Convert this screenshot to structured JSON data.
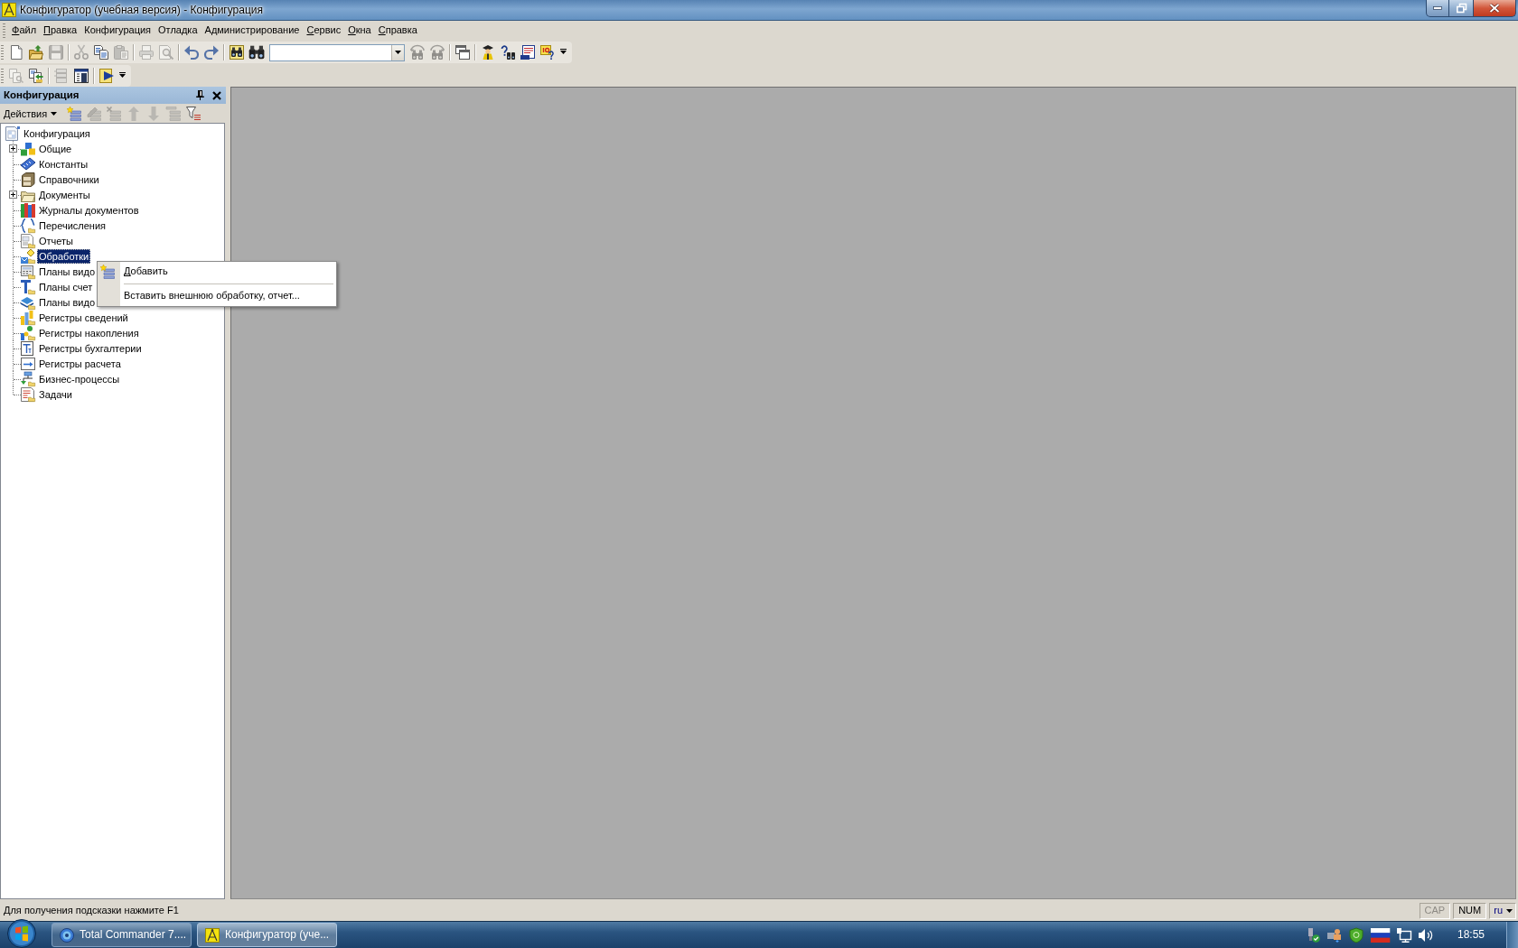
{
  "window": {
    "title": "Конфигуратор (учебная версия) - Конфигурация"
  },
  "menu_bar": [
    {
      "label": "Файл",
      "mnemonic": true
    },
    {
      "label": "Правка",
      "mnemonic": true
    },
    {
      "label": "Конфигурация",
      "mnemonic": false
    },
    {
      "label": "Отладка",
      "mnemonic": false
    },
    {
      "label": "Администрирование",
      "mnemonic": false
    },
    {
      "label": "Сервис",
      "mnemonic": true
    },
    {
      "label": "Окна",
      "mnemonic": true
    },
    {
      "label": "Справка",
      "mnemonic": true
    }
  ],
  "toolbars": [
    {
      "items": [
        {
          "kind": "button",
          "disabled": false
        },
        {
          "kind": "button",
          "disabled": false
        },
        {
          "kind": "button",
          "disabled": true
        },
        {
          "kind": "separator"
        },
        {
          "kind": "button",
          "disabled": true
        },
        {
          "kind": "button",
          "disabled": false
        },
        {
          "kind": "button",
          "disabled": true
        },
        {
          "kind": "separator"
        },
        {
          "kind": "button",
          "disabled": true
        },
        {
          "kind": "button",
          "disabled": true
        },
        {
          "kind": "separator"
        },
        {
          "kind": "button",
          "disabled": false
        },
        {
          "kind": "button",
          "disabled": false
        },
        {
          "kind": "separator"
        },
        {
          "kind": "button",
          "disabled": false
        },
        {
          "kind": "button",
          "disabled": false
        },
        {
          "kind": "combo"
        },
        {
          "kind": "button",
          "disabled": true
        },
        {
          "kind": "button",
          "disabled": true
        },
        {
          "kind": "separator"
        },
        {
          "kind": "button",
          "disabled": false
        },
        {
          "kind": "separator"
        },
        {
          "kind": "button",
          "disabled": false
        },
        {
          "kind": "button",
          "disabled": false
        },
        {
          "kind": "button",
          "disabled": false
        },
        {
          "kind": "button",
          "disabled": false
        },
        {
          "kind": "dropdown"
        }
      ]
    },
    {
      "items": [
        {
          "kind": "button",
          "disabled": true
        },
        {
          "kind": "button",
          "disabled": false
        },
        {
          "kind": "separator"
        },
        {
          "kind": "button",
          "disabled": true
        },
        {
          "kind": "button",
          "disabled": false
        },
        {
          "kind": "separator"
        },
        {
          "kind": "button",
          "disabled": false
        },
        {
          "kind": "dropdown"
        }
      ]
    }
  ],
  "config_panel": {
    "title": "Конфигурация",
    "actions_label": "Действия",
    "actions": [
      {
        "disabled": false
      },
      {
        "disabled": true
      },
      {
        "disabled": true
      },
      {
        "disabled": true
      },
      {
        "disabled": true
      },
      {
        "disabled": true
      },
      {
        "disabled": false
      }
    ],
    "tree": {
      "label": "Конфигурация",
      "children": [
        {
          "label": "Общие",
          "expandable": true,
          "selected": false
        },
        {
          "label": "Константы",
          "expandable": false,
          "selected": false
        },
        {
          "label": "Справочники",
          "expandable": false,
          "selected": false
        },
        {
          "label": "Документы",
          "expandable": true,
          "selected": false
        },
        {
          "label": "Журналы документов",
          "expandable": false,
          "selected": false
        },
        {
          "label": "Перечисления",
          "expandable": false,
          "selected": false
        },
        {
          "label": "Отчеты",
          "expandable": false,
          "selected": false
        },
        {
          "label": "Обработки",
          "expandable": false,
          "selected": true
        },
        {
          "label": "Планы видо",
          "expandable": false,
          "selected": false
        },
        {
          "label": "Планы счет",
          "expandable": false,
          "selected": false
        },
        {
          "label": "Планы видо",
          "expandable": false,
          "selected": false
        },
        {
          "label": "Регистры сведений",
          "expandable": false,
          "selected": false
        },
        {
          "label": "Регистры накопления",
          "expandable": false,
          "selected": false
        },
        {
          "label": "Регистры бухгалтерии",
          "expandable": false,
          "selected": false
        },
        {
          "label": "Регистры расчета",
          "expandable": false,
          "selected": false
        },
        {
          "label": "Бизнес-процессы",
          "expandable": false,
          "selected": false
        },
        {
          "label": "Задачи",
          "expandable": false,
          "selected": false
        }
      ]
    }
  },
  "context_menu": {
    "items": [
      {
        "kind": "item",
        "label": "Добавить",
        "mnemonic": true
      },
      {
        "kind": "separator"
      },
      {
        "kind": "item",
        "label": "Вставить внешнюю обработку, отчет...",
        "mnemonic": false
      }
    ]
  },
  "status_bar": {
    "hint": "Для получения подсказки нажмите F1",
    "indicators": [
      {
        "label": "CAP",
        "on": false
      },
      {
        "label": "NUM",
        "on": true
      }
    ],
    "language": "ru"
  },
  "taskbar": {
    "tasks": [
      {
        "label": "Total Commander 7....",
        "selected": false
      },
      {
        "label": "Конфигуратор (уче...",
        "selected": true
      }
    ],
    "clock": "18:55"
  }
}
